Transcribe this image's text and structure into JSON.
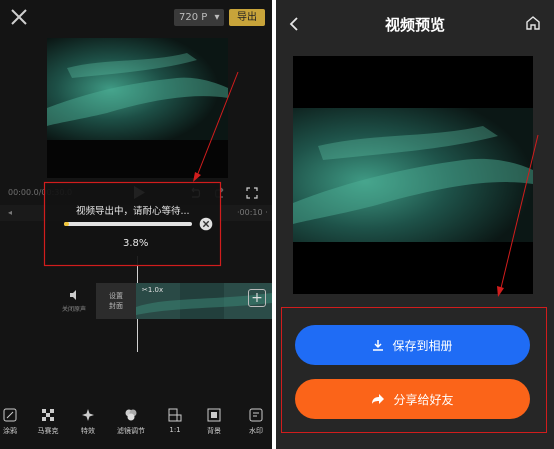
{
  "left": {
    "resolution": "720 P",
    "resolution_arrow": "▾",
    "export_label": "导出",
    "timecode": "00:00.0/00:30.0",
    "timeline_left": "◂",
    "timeline_right": "·00:10 ·",
    "dialog": {
      "message": "视频导出中，请耐心等待...",
      "progress_percent": 3.8,
      "percent_label": "3.8%"
    },
    "clip": {
      "cover_label_line1": "设置",
      "cover_label_line2": "封面",
      "tag": "✂1.0x",
      "volume_label": "关闭原声"
    },
    "tools": [
      {
        "icon": "brush-icon",
        "label": "涂鸦"
      },
      {
        "icon": "mosaic-icon",
        "label": "马赛克"
      },
      {
        "icon": "effects-icon",
        "label": "特效"
      },
      {
        "icon": "filter-icon",
        "label": "滤镜调节"
      },
      {
        "icon": "ratio-icon",
        "label": "1:1"
      },
      {
        "icon": "background-icon",
        "label": "背景"
      },
      {
        "icon": "watermark-icon",
        "label": "水印"
      }
    ]
  },
  "right": {
    "title": "视频预览",
    "save_label": "保存到相册",
    "share_label": "分享给好友"
  },
  "colors": {
    "accent_gold": "#c8a43a",
    "progress_fill": "#f0c53a",
    "save_blue": "#1f6cf5",
    "share_orange": "#fb6419",
    "annotation_red": "#d11d1d"
  }
}
